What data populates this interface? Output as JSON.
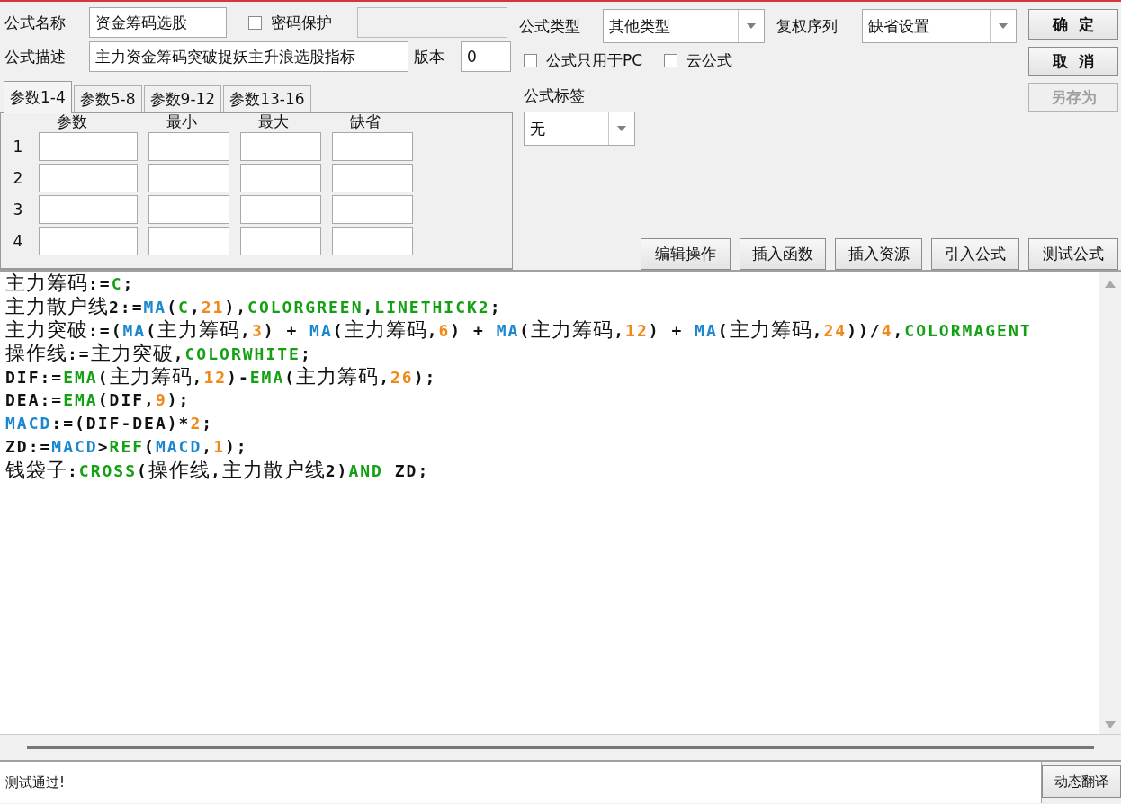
{
  "name_field": {
    "label": "公式名称",
    "value": "资金筹码选股"
  },
  "password": {
    "label": "密码保护",
    "checked": false
  },
  "password_field": {
    "disabled": true
  },
  "description_field": {
    "label": "公式描述",
    "value": "主力资金筹码突破捉妖主升浪选股指标"
  },
  "version_field": {
    "label": "版本",
    "value": "0"
  },
  "param_tabs": [
    {
      "label": "参数1-4",
      "selected": true
    },
    {
      "label": "参数5-8",
      "selected": false
    },
    {
      "label": "参数9-12",
      "selected": false
    },
    {
      "label": "参数13-16",
      "selected": false
    }
  ],
  "param_table": {
    "columns": [
      "参数",
      "最小",
      "最大",
      "缺省"
    ],
    "rows": [
      {
        "index": "1"
      },
      {
        "index": "2"
      },
      {
        "index": "3"
      },
      {
        "index": "4"
      }
    ]
  },
  "formula_type": {
    "label": "公式类型",
    "value": "其他类型"
  },
  "adjust_series": {
    "label": "复权序列",
    "value": "缺省设置"
  },
  "options": [
    {
      "label": "公式只用于PC",
      "checked": false
    },
    {
      "label": "云公式",
      "checked": false
    }
  ],
  "formula_tag": {
    "label": "公式标签",
    "value": "无"
  },
  "side_buttons": [
    {
      "label": "确  定",
      "disabled": false
    },
    {
      "label": "取  消",
      "disabled": false
    },
    {
      "label": "另存为",
      "disabled": true
    }
  ],
  "tool_buttons": [
    "编辑操作",
    "插入函数",
    "插入资源",
    "引入公式",
    "测试公式"
  ],
  "code": [
    {
      "tokens": [
        {
          "kind": "plain",
          "text": "主力筹码:="
        },
        {
          "kind": "func",
          "text": "C"
        },
        {
          "kind": "plain",
          "text": ";"
        }
      ]
    },
    {
      "tokens": [
        {
          "kind": "plain",
          "text": "主力散户线2:="
        },
        {
          "kind": "var",
          "text": "MA"
        },
        {
          "kind": "plain",
          "text": "("
        },
        {
          "kind": "func",
          "text": "C"
        },
        {
          "kind": "plain",
          "text": ","
        },
        {
          "kind": "num",
          "text": "21"
        },
        {
          "kind": "plain",
          "text": "),"
        },
        {
          "kind": "func",
          "text": "COLORGREEN"
        },
        {
          "kind": "plain",
          "text": ","
        },
        {
          "kind": "func",
          "text": "LINETHICK2"
        },
        {
          "kind": "plain",
          "text": ";"
        }
      ]
    },
    {
      "tokens": [
        {
          "kind": "plain",
          "text": "主力突破:=("
        },
        {
          "kind": "var",
          "text": "MA"
        },
        {
          "kind": "plain",
          "text": "(主力筹码,"
        },
        {
          "kind": "num",
          "text": "3"
        },
        {
          "kind": "plain",
          "text": ") + "
        },
        {
          "kind": "var",
          "text": "MA"
        },
        {
          "kind": "plain",
          "text": "(主力筹码,"
        },
        {
          "kind": "num",
          "text": "6"
        },
        {
          "kind": "plain",
          "text": ") + "
        },
        {
          "kind": "var",
          "text": "MA"
        },
        {
          "kind": "plain",
          "text": "(主力筹码,"
        },
        {
          "kind": "num",
          "text": "12"
        },
        {
          "kind": "plain",
          "text": ") + "
        },
        {
          "kind": "var",
          "text": "MA"
        },
        {
          "kind": "plain",
          "text": "(主力筹码,"
        },
        {
          "kind": "num",
          "text": "24"
        },
        {
          "kind": "plain",
          "text": "))/"
        },
        {
          "kind": "num",
          "text": "4"
        },
        {
          "kind": "plain",
          "text": ","
        },
        {
          "kind": "func",
          "text": "COLORMAGENT"
        }
      ]
    },
    {
      "tokens": [
        {
          "kind": "plain",
          "text": "操作线:=主力突破,"
        },
        {
          "kind": "func",
          "text": "COLORWHITE"
        },
        {
          "kind": "plain",
          "text": ";"
        }
      ]
    },
    {
      "tokens": [
        {
          "kind": "plain",
          "text": "DIF:="
        },
        {
          "kind": "func",
          "text": "EMA"
        },
        {
          "kind": "plain",
          "text": "(主力筹码,"
        },
        {
          "kind": "num",
          "text": "12"
        },
        {
          "kind": "plain",
          "text": ")-"
        },
        {
          "kind": "func",
          "text": "EMA"
        },
        {
          "kind": "plain",
          "text": "(主力筹码,"
        },
        {
          "kind": "num",
          "text": "26"
        },
        {
          "kind": "plain",
          "text": ");"
        }
      ]
    },
    {
      "tokens": [
        {
          "kind": "plain",
          "text": "DEA:="
        },
        {
          "kind": "func",
          "text": "EMA"
        },
        {
          "kind": "plain",
          "text": "(DIF,"
        },
        {
          "kind": "num",
          "text": "9"
        },
        {
          "kind": "plain",
          "text": ");"
        }
      ]
    },
    {
      "tokens": [
        {
          "kind": "var",
          "text": "MACD"
        },
        {
          "kind": "plain",
          "text": ":=(DIF-DEA)*"
        },
        {
          "kind": "num",
          "text": "2"
        },
        {
          "kind": "plain",
          "text": ";"
        }
      ]
    },
    {
      "tokens": [
        {
          "kind": "plain",
          "text": "ZD:="
        },
        {
          "kind": "var",
          "text": "MACD"
        },
        {
          "kind": "plain",
          "text": ">"
        },
        {
          "kind": "func",
          "text": "REF"
        },
        {
          "kind": "plain",
          "text": "("
        },
        {
          "kind": "var",
          "text": "MACD"
        },
        {
          "kind": "plain",
          "text": ","
        },
        {
          "kind": "num",
          "text": "1"
        },
        {
          "kind": "plain",
          "text": ");"
        }
      ]
    },
    {
      "tokens": [
        {
          "kind": "plain",
          "text": "钱袋子:"
        },
        {
          "kind": "func",
          "text": "CROSS"
        },
        {
          "kind": "plain",
          "text": "(操作线,主力散户线2)"
        },
        {
          "kind": "func",
          "text": "AND"
        },
        {
          "kind": "plain",
          "text": " ZD;"
        }
      ]
    }
  ],
  "status": {
    "message": "测试通过!",
    "button": "动态翻译"
  }
}
